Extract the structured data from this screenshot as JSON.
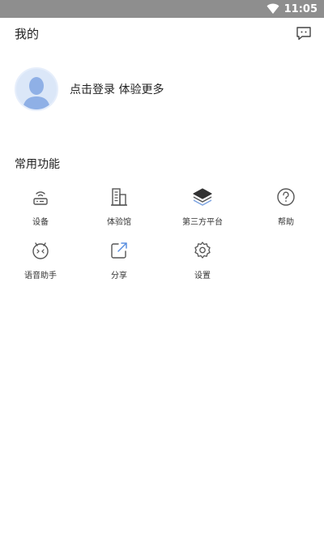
{
  "status_bar": {
    "time": "11:05",
    "wifi_icon": "wifi-icon"
  },
  "header": {
    "title": "我的",
    "message_icon": "message-icon"
  },
  "profile": {
    "login_prompt": "点击登录 体验更多",
    "avatar_icon": "default-avatar"
  },
  "features": {
    "title": "常用功能",
    "items": [
      {
        "label": "设备",
        "icon": "router-icon"
      },
      {
        "label": "体验馆",
        "icon": "building-icon"
      },
      {
        "label": "第三方平台",
        "icon": "layers-icon"
      },
      {
        "label": "帮助",
        "icon": "help-icon"
      },
      {
        "label": "语音助手",
        "icon": "robot-icon"
      },
      {
        "label": "分享",
        "icon": "share-icon"
      },
      {
        "label": "设置",
        "icon": "settings-icon"
      }
    ]
  },
  "colors": {
    "status_bar": "#8e8e8e",
    "icon_stroke": "#555555",
    "avatar_bg": "#dfe9f8",
    "avatar_figure": "#8fb0e6"
  }
}
